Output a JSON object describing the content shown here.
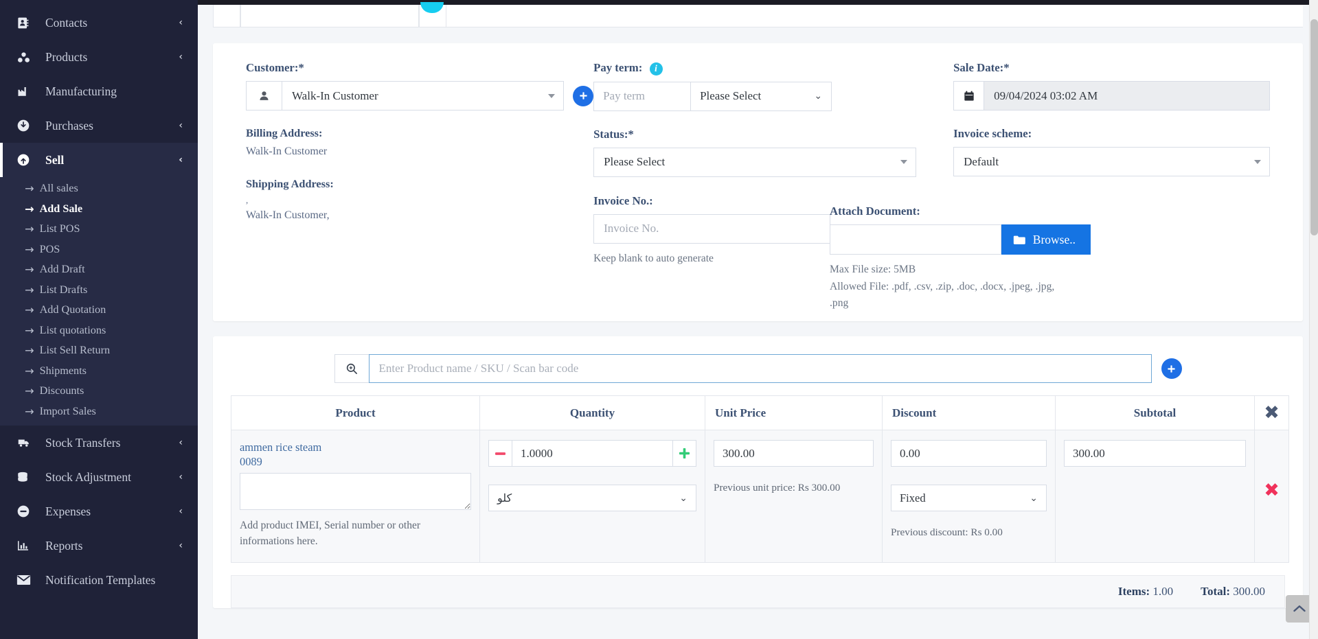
{
  "sidebar": {
    "items": [
      {
        "label": "Contacts",
        "icon": "contacts-icon",
        "chevron": "‹",
        "active": false
      },
      {
        "label": "Products",
        "icon": "products-icon",
        "chevron": "‹",
        "active": false
      },
      {
        "label": "Manufacturing",
        "icon": "factory-icon",
        "chevron": "",
        "active": false
      },
      {
        "label": "Purchases",
        "icon": "purchases-icon",
        "chevron": "‹",
        "active": false
      },
      {
        "label": "Sell",
        "icon": "sell-icon",
        "chevron": "‹",
        "active": true
      }
    ],
    "sell_submenu": [
      {
        "label": "All sales",
        "current": false
      },
      {
        "label": "Add Sale",
        "current": true
      },
      {
        "label": "List POS",
        "current": false
      },
      {
        "label": "POS",
        "current": false
      },
      {
        "label": "Add Draft",
        "current": false
      },
      {
        "label": "List Drafts",
        "current": false
      },
      {
        "label": "Add Quotation",
        "current": false
      },
      {
        "label": "List quotations",
        "current": false
      },
      {
        "label": "List Sell Return",
        "current": false
      },
      {
        "label": "Shipments",
        "current": false
      },
      {
        "label": "Discounts",
        "current": false
      },
      {
        "label": "Import Sales",
        "current": false
      }
    ],
    "items_after": [
      {
        "label": "Stock Transfers",
        "icon": "truck-icon",
        "chevron": "‹"
      },
      {
        "label": "Stock Adjustment",
        "icon": "database-icon",
        "chevron": "‹"
      },
      {
        "label": "Expenses",
        "icon": "minus-circle-icon",
        "chevron": "‹"
      },
      {
        "label": "Reports",
        "icon": "bar-chart-icon",
        "chevron": "‹"
      },
      {
        "label": "Notification Templates",
        "icon": "envelope-icon",
        "chevron": ""
      }
    ],
    "arrow_glyph": "→"
  },
  "customer_card": {
    "customer_label": "Customer:*",
    "customer_value": "Walk-In Customer",
    "add_customer_label": "+",
    "billing_label": "Billing Address:",
    "billing_value": "Walk-In Customer",
    "shipping_label": "Shipping Address:",
    "shipping_line1": ",",
    "shipping_line2": "Walk-In Customer,",
    "pay_term_label": "Pay term:",
    "pay_term_info": "i",
    "pay_term_placeholder": "Pay term",
    "pay_term_period": "Please Select",
    "status_label": "Status:*",
    "status_value": "Please Select",
    "invoice_no_label": "Invoice No.:",
    "invoice_no_placeholder": "Invoice No.",
    "invoice_no_help": "Keep blank to auto generate",
    "sale_date_label": "Sale Date:*",
    "sale_date_value": "09/04/2024 03:02 AM",
    "invoice_scheme_label": "Invoice scheme:",
    "invoice_scheme_value": "Default",
    "attach_label": "Attach Document:",
    "browse_label": "Browse..",
    "max_file_size": "Max File size: 5MB",
    "allowed_file": "Allowed File: .pdf, .csv, .zip, .doc, .docx, .jpeg, .jpg, .png"
  },
  "products_card": {
    "search_placeholder": "Enter Product name / SKU / Scan bar code",
    "search_value": "",
    "add_product_label": "+",
    "columns": [
      "Product",
      "Quantity",
      "Unit Price",
      "Discount",
      "Subtotal"
    ],
    "header_remove_all": "✖",
    "rows": [
      {
        "product_name": "ammen rice steam",
        "product_sku": "0089",
        "imei_value": "",
        "imei_help": "Add product IMEI, Serial number or other informations here.",
        "qty_minus": "−",
        "qty_value": "1.0000",
        "qty_plus": "+",
        "unit": "كلو",
        "unit_price": "300.00",
        "prev_unit_price": "Previous unit price: Rs 300.00",
        "discount": "0.00",
        "discount_type": "Fixed",
        "prev_discount": "Previous discount: Rs 0.00",
        "subtotal": "300.00",
        "remove": "✖"
      }
    ],
    "items_label": "Items:",
    "items_value": "1.00",
    "total_label": "Total:",
    "total_value": "300.00"
  },
  "misc": {
    "scroll_top_glyph": "⌃"
  },
  "colors": {
    "sidebar_bg": "#1f2238",
    "sidebar_active_bg": "#272b45",
    "primary_blue": "#1574e3",
    "accent_cyan": "#23c1e8",
    "danger_red": "#f0325b",
    "success_green": "#33cc77",
    "label_navy": "#3c5173"
  }
}
